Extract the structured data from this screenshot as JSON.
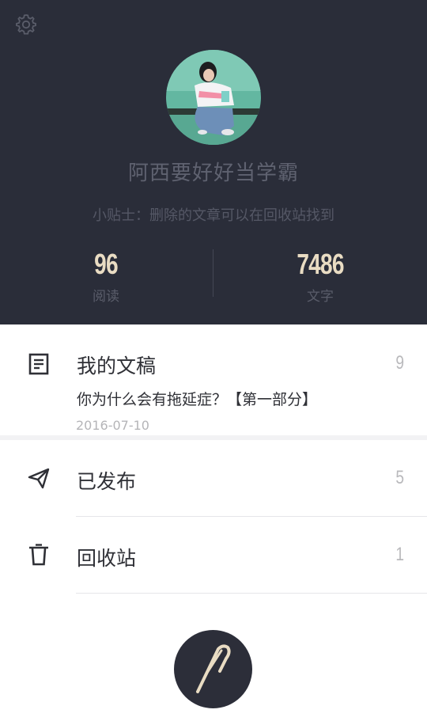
{
  "profile": {
    "username": "阿西要好好当学霸",
    "tip": "小贴士：删除的文章可以在回收站找到"
  },
  "stats": {
    "reads_value": "96",
    "reads_label": "阅读",
    "words_value": "7486",
    "words_label": "文字"
  },
  "menu": {
    "drafts": {
      "title": "我的文稿",
      "count": "9",
      "latest_title": "你为什么会有拖延症？【第一部分】",
      "latest_date": "2016-07-10"
    },
    "published": {
      "title": "已发布",
      "count": "5"
    },
    "trash": {
      "title": "回收站",
      "count": "1"
    }
  },
  "colors": {
    "header_bg": "#2a2d39",
    "stat_number": "#e9dcc3",
    "fab_bg": "#2c2e39"
  },
  "icons": {
    "settings": "gear-icon",
    "drafts": "document-icon",
    "published": "paper-plane-icon",
    "trash": "trash-icon",
    "fab": "pen-icon"
  }
}
